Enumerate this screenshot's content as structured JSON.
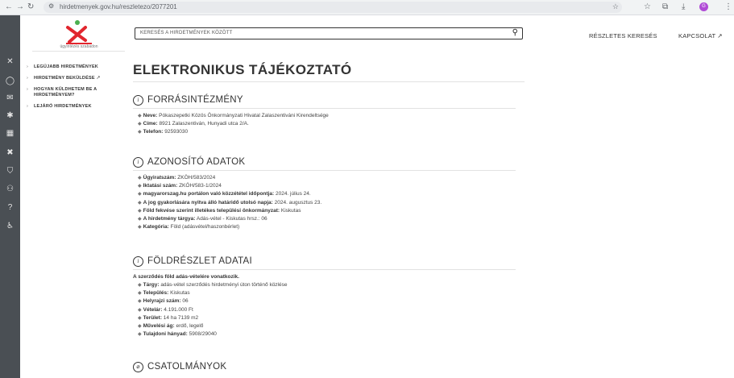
{
  "browser": {
    "url": "hirdetmenyek.gov.hu/reszletezo/2077201",
    "profile_initial": "G"
  },
  "logo": {
    "caption": "ügyintézés szabadon"
  },
  "search": {
    "placeholder": "KERESÉS A HIRDETMÉNYEK KÖZÖTT"
  },
  "top_links": {
    "advanced_search": "RÉSZLETES KERESÉS",
    "contact": "KAPCSOLAT"
  },
  "nav": [
    {
      "label": "LEGÚJABB HIRDETMÉNYEK"
    },
    {
      "label": "HIRDETMÉNY BEKÜLDÉSE"
    },
    {
      "label": "HOGYAN KÜLDHETEM BE A HIRDETMÉNYEM?"
    },
    {
      "label": "LEJÁRÓ HIRDETMÉNYEK"
    }
  ],
  "page_title": "ELEKTRONIKUS TÁJÉKOZTATÓ",
  "sections": {
    "forras": {
      "title": "FORRÁSINTÉZMÉNY",
      "rows": [
        {
          "label": "Neve:",
          "value": "Pókaszepetki Közös Önkormányzati Hivatal Zalaszentiváni Kirendeltsége"
        },
        {
          "label": "Címe:",
          "value": "8921 Zalaszentiván, Hunyadi utca 2/A."
        },
        {
          "label": "Telefon:",
          "value": "92593030"
        }
      ]
    },
    "azonosito": {
      "title": "AZONOSÍTÓ ADATOK",
      "rows": [
        {
          "label": "Ügyiratszám:",
          "value": "ZKÖH/583/2024"
        },
        {
          "label": "Iktatási szám:",
          "value": "ZKÖH/583-1/2024"
        },
        {
          "label": "magyarorszag.hu portálon való közzététel időpontja:",
          "value": "2024. július 24."
        },
        {
          "label": "A jog gyakorlására nyitva álló határidő utolsó napja:",
          "value": "2024. augusztus 23."
        },
        {
          "label": "Föld fekvése szerint illetékes települési önkormányzat:",
          "value": "Kiskutas"
        },
        {
          "label": "A hirdetmény tárgya:",
          "value": "Adás-vétel - Kiskutas hrsz.: 06"
        },
        {
          "label": "Kategória:",
          "value": "Föld (adásvétel/haszonbérlet)"
        }
      ]
    },
    "foldreszlet": {
      "title": "FÖLDRÉSZLET ADATAI",
      "lead": "A szerződés föld adás-vételére vonatkozik.",
      "rows": [
        {
          "label": "Tárgy:",
          "value": "adás-vétel szerződés hirdetményi úton történő közlése"
        },
        {
          "label": "Település:",
          "value": "Kiskutas"
        },
        {
          "label": "Helyrajzi szám:",
          "value": "06"
        },
        {
          "label": "Vételár:",
          "value": "4.191.000 Ft"
        },
        {
          "label": "Terület:",
          "value": "14 ha 7139 m2"
        },
        {
          "label": "Művelési ág:",
          "value": "erdő, legelő"
        },
        {
          "label": "Tulajdoni hányad:",
          "value": "5908/29040"
        }
      ]
    },
    "csatolmanyok": {
      "title": "CSATOLMÁNYOK"
    }
  }
}
